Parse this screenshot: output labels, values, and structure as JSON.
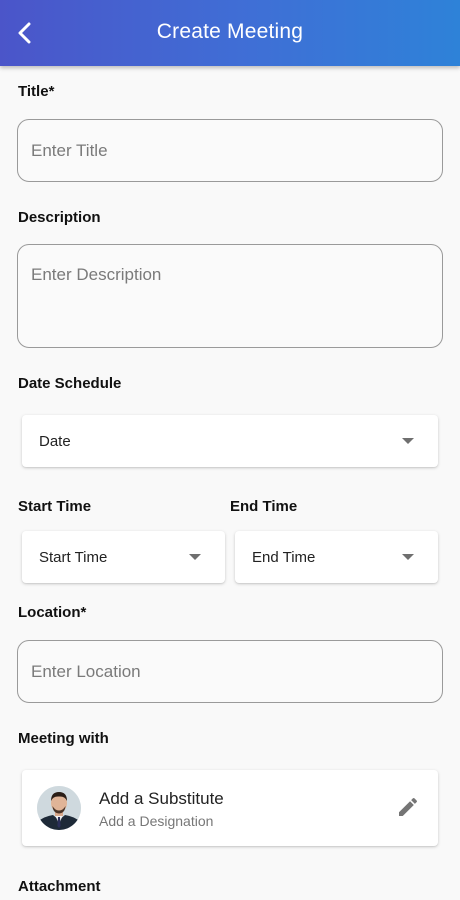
{
  "header": {
    "title": "Create Meeting",
    "back_icon": "chevron-left-icon"
  },
  "form": {
    "title_label": "Title*",
    "title_placeholder": "Enter Title",
    "description_label": "Description",
    "description_placeholder": "Enter Description",
    "date_label": "Date Schedule",
    "date_value": "Date",
    "start_time_label": "Start Time",
    "start_time_value": "Start Time",
    "end_time_label": "End Time",
    "end_time_value": "End Time",
    "location_label": "Location*",
    "location_placeholder": "Enter Location",
    "meeting_with_label": "Meeting with",
    "attachment_label": "Attachment"
  },
  "member": {
    "name": "Add a Substitute",
    "designation": "Add a Designation",
    "edit_icon": "pencil-icon"
  },
  "colors": {
    "header_gradient_start": "#4b55c9",
    "header_gradient_end": "#2e82d8",
    "background": "#f9f9f9"
  }
}
